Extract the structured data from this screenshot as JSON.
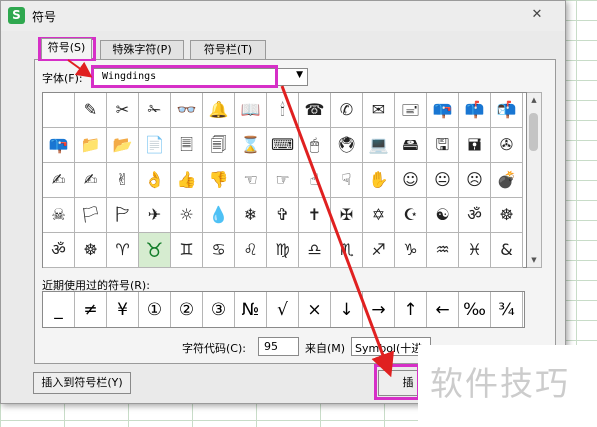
{
  "window": {
    "title": "符号",
    "app_icon": "S",
    "close_glyph": "✕"
  },
  "tabs": [
    {
      "label": "符号(S)",
      "active": true
    },
    {
      "label": "特殊字符(P)",
      "active": false
    },
    {
      "label": "符号栏(T)",
      "active": false
    }
  ],
  "font": {
    "label": "字体(F):",
    "value": "Wingdings",
    "arrow": "▼"
  },
  "symbol_grid": {
    "rows": [
      [
        " ",
        "✎",
        "✂",
        "✁",
        "👓",
        "🔔",
        "📖",
        "🕯",
        "☎",
        "✆",
        "✉",
        "🖃",
        "📪",
        "📫",
        "📬"
      ],
      [
        "📪",
        "📁",
        "📂",
        "📄",
        "🗏",
        "🗐",
        "⌛",
        "⌨",
        "🖱",
        "🖲",
        "💻",
        "🖴",
        "🖫",
        "🖬",
        "✇"
      ],
      [
        "✍",
        "✍",
        "✌",
        "👌",
        "👍",
        "👎",
        "☜",
        "☞",
        "☝",
        "☟",
        "✋",
        "☺",
        "😐",
        "☹",
        "💣"
      ],
      [
        "☠",
        "🏳",
        "🏱",
        "✈",
        "☼",
        "💧",
        "❄",
        "✞",
        "✝",
        "✠",
        "✡",
        "☪",
        "☯",
        "ॐ",
        "☸"
      ],
      [
        "ॐ",
        "☸",
        "♈",
        "♉",
        "♊",
        "♋",
        "♌",
        "♍",
        "♎",
        "♏",
        "♐",
        "♑",
        "♒",
        "♓",
        "&"
      ]
    ],
    "selected": {
      "row": 4,
      "col": 3
    }
  },
  "recent": {
    "label": "近期使用过的符号(R):",
    "symbols": [
      "_",
      "≠",
      "¥",
      "①",
      "②",
      "③",
      "№",
      "√",
      "×",
      "↓",
      "→",
      "↑",
      "←",
      "‰",
      "¾"
    ]
  },
  "char_code": {
    "label": "字符代码(C):",
    "value": "95"
  },
  "from": {
    "label": "来自(M)",
    "value": "Symbol(十进"
  },
  "buttons": {
    "insert_to_bar": "插入到符号栏(Y)",
    "insert": "插"
  },
  "watermark": "软件技巧",
  "colors": {
    "highlight": "#d62fc7",
    "arrow": "#e02020",
    "selected_cell": "#d6ecd0"
  }
}
